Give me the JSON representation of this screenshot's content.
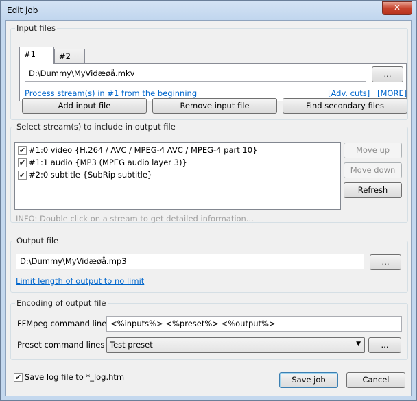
{
  "window": {
    "title": "Edit job",
    "close": "✕"
  },
  "input_files": {
    "group_label": "Input files",
    "tabs": [
      {
        "label": "#1"
      },
      {
        "label": "#2"
      }
    ],
    "path": "D:\\Dummy\\MyVidæøå.mkv",
    "browse": "...",
    "process_link": "Process stream(s) in #1 from the beginning",
    "adv_cuts_link": "[Adv. cuts]",
    "more_link": "[MORE]",
    "add_button": "Add input file",
    "remove_button": "Remove input file",
    "find_secondary_button": "Find secondary files"
  },
  "streams": {
    "group_label": "Select stream(s) to include in output file",
    "items": [
      {
        "label": "#1:0 video {H.264 / AVC / MPEG-4 AVC / MPEG-4 part 10}",
        "checked": true
      },
      {
        "label": "#1:1 audio {MP3 (MPEG audio layer 3)}",
        "checked": true
      },
      {
        "label": "#2:0 subtitle {SubRip subtitle}",
        "checked": true
      }
    ],
    "move_up": "Move up",
    "move_down": "Move down",
    "refresh": "Refresh",
    "info": "INFO: Double click on a stream to get detailed information..."
  },
  "output_file": {
    "group_label": "Output file",
    "path": "D:\\Dummy\\MyVidæøå.mp3",
    "browse": "...",
    "limit_link": "Limit length of output to no limit"
  },
  "encoding": {
    "group_label": "Encoding of output file",
    "ffmpeg_label": "FFMpeg command line",
    "ffmpeg_value": "<%inputs%> <%preset%> <%output%>",
    "preset_label": "Preset command lines",
    "preset_value": "Test preset",
    "preset_browse": "..."
  },
  "footer": {
    "save_log_label": "Save log file to *_log.htm",
    "save_log_checked": true,
    "save_job": "Save job",
    "cancel": "Cancel"
  },
  "icons": {
    "check": "✔",
    "dropdown": "▼"
  }
}
